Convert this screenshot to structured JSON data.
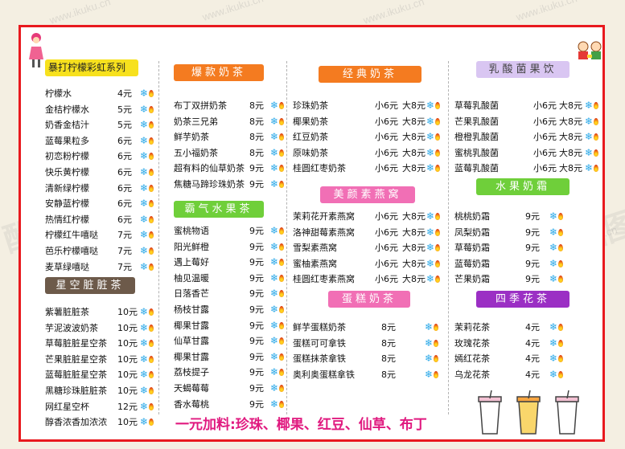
{
  "watermark_text": "www.ikuku.cn",
  "watermark_logo": "酷图网",
  "footer": "一元加料:珍珠、椰果、红豆、仙草、布丁",
  "colors": {
    "frame": "#e8191e",
    "snow": "#29a8e8",
    "footer": "#e0197f"
  },
  "sections": {
    "lemon": {
      "title": "暴打柠檬彩虹系列",
      "items": [
        {
          "name": "柠檬水",
          "price": "4元"
        },
        {
          "name": "金桔柠檬水",
          "price": "5元"
        },
        {
          "name": "奶香金桔汁",
          "price": "5元"
        },
        {
          "name": "蓝莓果粒多",
          "price": "6元"
        },
        {
          "name": "初恋粉柠檬",
          "price": "6元"
        },
        {
          "name": "快乐黄柠檬",
          "price": "6元"
        },
        {
          "name": "清新绿柠檬",
          "price": "6元"
        },
        {
          "name": "安静蓝柠檬",
          "price": "6元"
        },
        {
          "name": "热情红柠檬",
          "price": "6元"
        },
        {
          "name": "柠檬红牛嘻哒",
          "price": "7元"
        },
        {
          "name": "芭乐柠檬嘻哒",
          "price": "7元"
        },
        {
          "name": "麦草绿嘻哒",
          "price": "7元"
        }
      ]
    },
    "starry": {
      "title": "星空脏脏茶",
      "items": [
        {
          "name": "紫薯脏脏茶",
          "price": "10元"
        },
        {
          "name": "芋泥波波奶茶",
          "price": "10元"
        },
        {
          "name": "草莓脏脏星空茶",
          "price": "10元"
        },
        {
          "name": "芒果脏脏星空茶",
          "price": "10元"
        },
        {
          "name": "蓝莓脏脏星空茶",
          "price": "10元"
        },
        {
          "name": "黑糖珍珠脏脏茶",
          "price": "10元"
        },
        {
          "name": "网红星空杯",
          "price": "12元"
        },
        {
          "name": "醇香浓香加浓浓",
          "price": "10元"
        }
      ]
    },
    "hot": {
      "title": "爆款奶茶",
      "items": [
        {
          "name": "布丁双拼奶茶",
          "price": "8元"
        },
        {
          "name": "奶茶三兄弟",
          "price": "8元"
        },
        {
          "name": "鲜芋奶茶",
          "price": "8元"
        },
        {
          "name": "五小福奶茶",
          "price": "8元"
        },
        {
          "name": "超有料的仙草奶茶",
          "price": "9元"
        },
        {
          "name": "焦糖马蹄珍珠奶茶",
          "price": "9元"
        }
      ]
    },
    "fruit": {
      "title": "霸气水果茶",
      "items": [
        {
          "name": "蜜桃物语",
          "price": "9元"
        },
        {
          "name": "阳光鲜橙",
          "price": "9元"
        },
        {
          "name": "遇上莓好",
          "price": "9元"
        },
        {
          "name": "柚见温暖",
          "price": "9元"
        },
        {
          "name": "日落香芒",
          "price": "9元"
        },
        {
          "name": "杨枝甘露",
          "price": "9元"
        },
        {
          "name": "椰果甘露",
          "price": "9元"
        },
        {
          "name": "仙草甘露",
          "price": "9元"
        },
        {
          "name": "椰果甘露",
          "price": "9元"
        },
        {
          "name": "荔枝提子",
          "price": "9元"
        },
        {
          "name": "天蝎莓莓",
          "price": "9元"
        },
        {
          "name": "香水莓桃",
          "price": "9元"
        }
      ]
    },
    "classic": {
      "title": "经典奶茶",
      "items": [
        {
          "name": "珍珠奶茶",
          "small": "小6元",
          "large": "大8元"
        },
        {
          "name": "椰果奶茶",
          "small": "小6元",
          "large": "大8元"
        },
        {
          "name": "红豆奶茶",
          "small": "小6元",
          "large": "大8元"
        },
        {
          "name": "原味奶茶",
          "small": "小6元",
          "large": "大8元"
        },
        {
          "name": "桂圆红枣奶茶",
          "small": "小6元",
          "large": "大8元"
        }
      ]
    },
    "beauty": {
      "title": "美颜素燕窝",
      "items": [
        {
          "name": "茉莉花开素燕窝",
          "small": "小6元",
          "large": "大8元"
        },
        {
          "name": "洛神甜莓素燕窝",
          "small": "小6元",
          "large": "大8元"
        },
        {
          "name": "雪梨素燕窝",
          "small": "小6元",
          "large": "大8元"
        },
        {
          "name": "蜜柚素燕窝",
          "small": "小6元",
          "large": "大8元"
        },
        {
          "name": "桂圆红枣素燕窝",
          "small": "小6元",
          "large": "大8元"
        }
      ]
    },
    "cake": {
      "title": "蛋糕奶茶",
      "items": [
        {
          "name": "鲜芋蛋糕奶茶",
          "price": "8元"
        },
        {
          "name": "蛋糕可可拿铁",
          "price": "8元"
        },
        {
          "name": "蛋糕抹茶拿铁",
          "price": "8元"
        },
        {
          "name": "奥利奥蛋糕拿铁",
          "price": "8元"
        }
      ]
    },
    "yogurt": {
      "title": "乳酸菌果饮",
      "items": [
        {
          "name": "草莓乳酸菌",
          "small": "小6元",
          "large": "大8元"
        },
        {
          "name": "芒果乳酸菌",
          "small": "小6元",
          "large": "大8元"
        },
        {
          "name": "橙橙乳酸菌",
          "small": "小6元",
          "large": "大8元"
        },
        {
          "name": "蜜桃乳酸菌",
          "small": "小6元",
          "large": "大8元"
        },
        {
          "name": "蓝莓乳酸菌",
          "small": "小6元",
          "large": "大8元"
        }
      ]
    },
    "frost": {
      "title": "水果奶霜",
      "items": [
        {
          "name": "桃桃奶霜",
          "price": "9元"
        },
        {
          "name": "凤梨奶霜",
          "price": "9元"
        },
        {
          "name": "草莓奶霜",
          "price": "9元"
        },
        {
          "name": "蓝莓奶霜",
          "price": "9元"
        },
        {
          "name": "芒果奶霜",
          "price": "9元"
        }
      ]
    },
    "flower": {
      "title": "四季花茶",
      "items": [
        {
          "name": "茉莉花茶",
          "price": "4元"
        },
        {
          "name": "玫瑰花茶",
          "price": "4元"
        },
        {
          "name": "嫣红花茶",
          "price": "4元"
        },
        {
          "name": "乌龙花茶",
          "price": "4元"
        }
      ]
    }
  }
}
